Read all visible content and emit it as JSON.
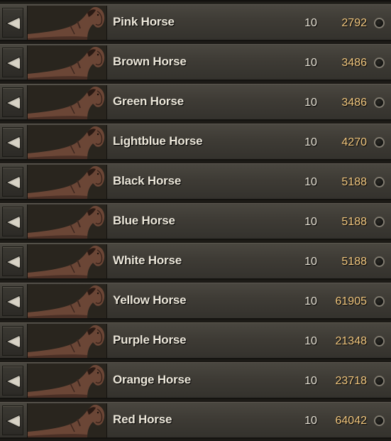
{
  "rows": [
    {
      "name": "Pink Horse",
      "qty": "10",
      "price": "2792",
      "color": "#6b4636"
    },
    {
      "name": "Brown Horse",
      "qty": "10",
      "price": "3486",
      "color": "#6b4636"
    },
    {
      "name": "Green Horse",
      "qty": "10",
      "price": "3486",
      "color": "#6b4636"
    },
    {
      "name": "Lightblue Horse",
      "qty": "10",
      "price": "4270",
      "color": "#6b4636"
    },
    {
      "name": "Black Horse",
      "qty": "10",
      "price": "5188",
      "color": "#6b4636"
    },
    {
      "name": "Blue Horse",
      "qty": "10",
      "price": "5188",
      "color": "#6b4636"
    },
    {
      "name": "White Horse",
      "qty": "10",
      "price": "5188",
      "color": "#6b4636"
    },
    {
      "name": "Yellow Horse",
      "qty": "10",
      "price": "61905",
      "color": "#6b4636"
    },
    {
      "name": "Purple Horse",
      "qty": "10",
      "price": "21348",
      "color": "#6b4636"
    },
    {
      "name": "Orange Horse",
      "qty": "10",
      "price": "23718",
      "color": "#6b4636"
    },
    {
      "name": "Red Horse",
      "qty": "10",
      "price": "64042",
      "color": "#6b4636"
    }
  ],
  "icons": {
    "row_button": "left-triangle-icon",
    "thumbnail": "horse-icon",
    "currency": "coin-icon"
  },
  "colors": {
    "name_text": "#ece7da",
    "price_text": "#f2c77e",
    "row_bg": "#3e3b35"
  }
}
